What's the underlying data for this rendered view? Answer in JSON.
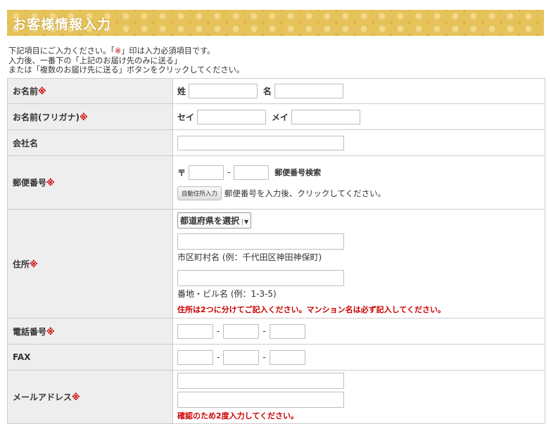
{
  "header": {
    "title": "お客様情報入力"
  },
  "intro": {
    "line1_prefix": "下記項目にご入力ください。「",
    "line1_star": "※",
    "line1_suffix": "」印は入力必須項目です。",
    "line2": "入力後、一番下の「上記のお届け先のみに送る」",
    "line3": "または「複数のお届け先に送る」ボタンをクリックしてください。"
  },
  "form": {
    "required_mark": "※",
    "name": {
      "label": "お名前",
      "sei": "姓",
      "mei": "名"
    },
    "kana": {
      "label": "お名前(フリガナ)",
      "sei": "セイ",
      "mei": "メイ"
    },
    "company": {
      "label": "会社名"
    },
    "zip": {
      "label": "郵便番号",
      "symbol": "〒",
      "dash": "-",
      "search_link": "郵便番号検索",
      "auto_button": "自動住所入力",
      "auto_hint": "郵便番号を入力後、クリックしてください。"
    },
    "address": {
      "label": "住所",
      "pref_select": "都道府県を選択",
      "hint_city": "市区町村名 (例：千代田区神田神保町)",
      "hint_street": "番地・ビル名 (例：1-3-5)",
      "note": "住所は2つに分けてご記入ください。マンション名は必ず記入してください。"
    },
    "tel": {
      "label": "電話番号",
      "dash": "-"
    },
    "fax": {
      "label": "FAX",
      "dash": "-"
    },
    "email": {
      "label": "メールアドレス",
      "note": "確認のため2度入力してください。"
    }
  }
}
